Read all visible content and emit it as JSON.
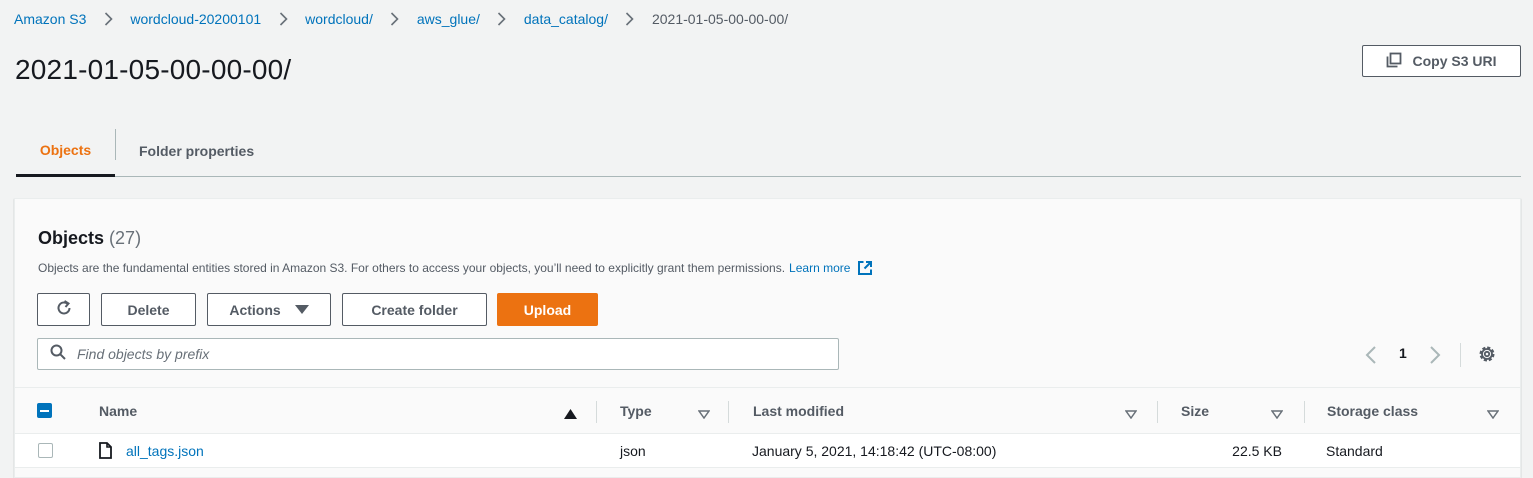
{
  "breadcrumb": {
    "items": [
      "Amazon S3",
      "wordcloud-20200101",
      "wordcloud/",
      "aws_glue/",
      "data_catalog/"
    ],
    "current": "2021-01-05-00-00-00/"
  },
  "page": {
    "title": "2021-01-05-00-00-00/",
    "copy_uri_label": "Copy S3 URI"
  },
  "tabs": [
    {
      "label": "Objects",
      "active": true
    },
    {
      "label": "Folder properties",
      "active": false
    }
  ],
  "objects_panel": {
    "title": "Objects",
    "count": "(27)",
    "description": "Objects are the fundamental entities stored in Amazon S3. For others to access your objects, you’ll need to explicitly grant them permissions.",
    "learn_more": "Learn more",
    "buttons": {
      "delete": "Delete",
      "actions": "Actions",
      "create_folder": "Create folder",
      "upload": "Upload"
    },
    "search": {
      "placeholder": "Find objects by prefix",
      "value": ""
    },
    "pagination": {
      "current_page": "1"
    }
  },
  "table": {
    "columns": [
      "Name",
      "Type",
      "Last modified",
      "Size",
      "Storage class"
    ],
    "rows": [
      {
        "name": "all_tags.json",
        "type": "json",
        "last_modified": "January 5, 2021, 14:18:42 (UTC-08:00)",
        "size": "22.5 KB",
        "storage_class": "Standard"
      }
    ]
  },
  "colors": {
    "link": "#0073bb",
    "accent": "#ec7211",
    "text": "#16191f",
    "muted": "#545b64"
  }
}
